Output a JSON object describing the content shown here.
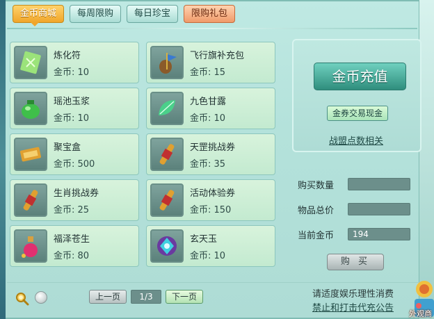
{
  "tabs": [
    {
      "label": "金币商城",
      "active": true
    },
    {
      "label": "每周限购",
      "active": false
    },
    {
      "label": "每日珍宝",
      "active": false
    },
    {
      "label": "限购礼包",
      "active": false
    }
  ],
  "currency_label": "金币: ",
  "items": [
    {
      "name": "炼化符",
      "price": "金币: 10",
      "icon": "talisman-icon"
    },
    {
      "name": "飞行旗补充包",
      "price": "金币: 15",
      "icon": "flag-pack-icon"
    },
    {
      "name": "瑶池玉浆",
      "price": "金币: 10",
      "icon": "jade-jar-icon"
    },
    {
      "name": "九色甘露",
      "price": "金币: 10",
      "icon": "leaf-dew-icon"
    },
    {
      "name": "聚宝盒",
      "price": "金币: 500",
      "icon": "treasure-box-icon"
    },
    {
      "name": "天罡挑战券",
      "price": "金币: 35",
      "icon": "scroll-icon"
    },
    {
      "name": "生肖挑战券",
      "price": "金币: 25",
      "icon": "scroll-icon"
    },
    {
      "name": "活动体验券",
      "price": "金币: 150",
      "icon": "scroll-icon"
    },
    {
      "name": "福泽苍生",
      "price": "金币: 80",
      "icon": "potion-icon"
    },
    {
      "name": "玄天玉",
      "price": "金币: 10",
      "icon": "gem-icon"
    }
  ],
  "right": {
    "recharge_label": "金币充值",
    "exchange_label": "金券交易现金",
    "alliance_label": "战盟点数相关",
    "quantity_label": "购买数量",
    "quantity_value": "",
    "total_label": "物品总价",
    "total_value": "",
    "current_label": "当前金币",
    "current_value": "194",
    "buy_label": "购 买"
  },
  "pager": {
    "prev_label": "上一页",
    "page_text": "1/3",
    "next_label": "下一页"
  },
  "notice": {
    "line1": "请适度娱乐理性消费",
    "line2": "禁止和打击代充公告"
  },
  "mascot_label": "外观商"
}
